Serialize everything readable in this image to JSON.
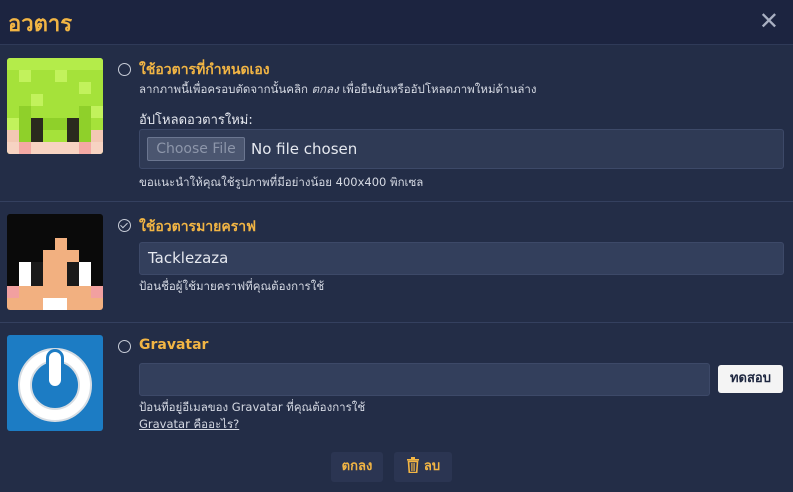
{
  "dialog": {
    "title": "อวตาร",
    "close_icon": "close-icon"
  },
  "custom_avatar": {
    "label": "ใช้อวตารที่กำหนดเอง",
    "hint_before": "ลากภาพนี้เพื่อครอบตัดจากนั้นคลิก ",
    "hint_em": "ตกลง",
    "hint_after": " เพื่อยืนยันหรืออัปโหลดภาพใหม่ด้านล่าง",
    "upload_label": "อัปโหลดอวตารใหม่:",
    "choose_file_label": "Choose File",
    "no_file_text": "No file chosen",
    "size_hint": "ขอแนะนำให้คุณใช้รูปภาพที่มีอย่างน้อย 400x400 พิกเซล",
    "selected": false
  },
  "minecraft_avatar": {
    "label": "ใช้อวตารมายคราฟ",
    "username_value": "Tacklezaza",
    "username_hint": "ป้อนชื่อผู้ใช้มายคราฟที่คุณต้องการใช้",
    "selected": true
  },
  "gravatar": {
    "label": "Gravatar",
    "email_value": "",
    "test_button": "ทดสอบ",
    "email_hint": "ป้อนที่อยู่อีเมลของ Gravatar ที่คุณต้องการใช้",
    "link_text": "Gravatar คืออะไร?",
    "selected": false
  },
  "footer": {
    "ok_label": "ตกลง",
    "delete_label": "ลบ",
    "delete_icon": "trash-icon"
  },
  "colors": {
    "accent": "#f2b544",
    "background": "#232d47",
    "gravatar_blue": "#1c7cc4"
  }
}
